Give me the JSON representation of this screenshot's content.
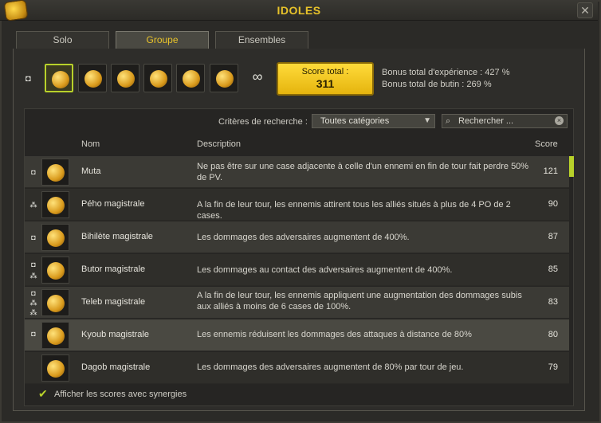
{
  "window": {
    "title": "IDOLES",
    "close": "✕"
  },
  "tabs": [
    {
      "label": "Solo",
      "active": false
    },
    {
      "label": "Groupe",
      "active": true
    },
    {
      "label": "Ensembles",
      "active": false
    }
  ],
  "score": {
    "label": "Score total :",
    "value": "311"
  },
  "bonus": {
    "xp": "Bonus total d'expérience : 427 %",
    "loot": "Bonus total de butin : 269 %"
  },
  "search": {
    "criteria_label": "Critères de recherche :",
    "category_selected": "Toutes catégories",
    "placeholder": "Rechercher ..."
  },
  "columns": {
    "name": "Nom",
    "description": "Description",
    "score": "Score"
  },
  "rows": [
    {
      "name": "Muta",
      "description": "Ne pas être sur une case adjacente à celle d'un ennemi en fin de tour fait perdre 50% de PV.",
      "score": "121"
    },
    {
      "name": "Pého magistrale",
      "description": "A la fin de leur tour, les ennemis attirent tous les alliés situés à plus de 4 PO de 2 cases.",
      "score": "90"
    },
    {
      "name": "Bihilète magistrale",
      "description": "Les dommages des adversaires augmentent de 400%.",
      "score": "87"
    },
    {
      "name": "Butor magistrale",
      "description": "Les dommages au contact des adversaires augmentent de 400%.",
      "score": "85"
    },
    {
      "name": "Teleb magistrale",
      "description": "A la fin de leur tour, les ennemis appliquent une augmentation des dommages subis aux alliés à moins de 6 cases de 100%.",
      "score": "83"
    },
    {
      "name": "Kyoub magistrale",
      "description": "Les ennemis réduisent les dommages des attaques à distance de 80%",
      "score": "80"
    },
    {
      "name": "Dagob magistrale",
      "description": "Les dommages des adversaires augmentent de 80% par tour de jeu.",
      "score": "79"
    }
  ],
  "footer": {
    "synergy_label": "Afficher les scores avec synergies",
    "synergy_checked": true
  },
  "colors": {
    "accent": "#e8c32a",
    "score_bg": "#ffdb3a",
    "selection": "#b8d12a"
  }
}
